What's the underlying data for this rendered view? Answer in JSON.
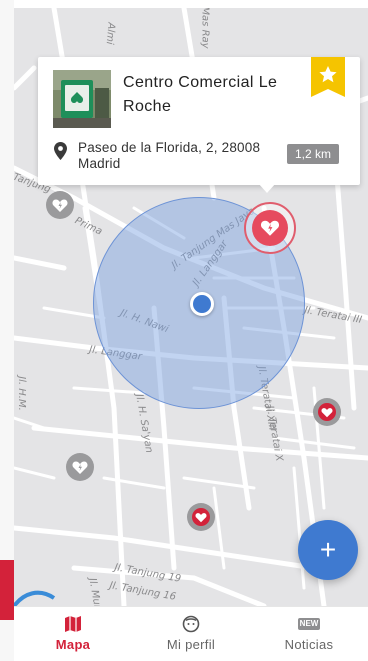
{
  "map": {
    "street_labels": [
      "Mas Ray",
      "Jl. Tanjung Mas Jaya",
      "Jl. Teratai III",
      "Jl. H. Nawi",
      "Jl. Langgar",
      "Jl. Langgar",
      "Jl. H. Sa'yan",
      "Jl. Teratai XIII",
      "Jl. Teratai X",
      "Jl. H.M.",
      "Jl. Tanjung 19",
      "Jl. Tanjung 16",
      "Tanjung",
      "Prima",
      "Almi",
      "Jl. Mur"
    ]
  },
  "card": {
    "title": "Centro Comercial Le Roche",
    "address": "Paseo de la Florida, 2, 28008 Madrid",
    "distance": "1,2 km",
    "favorite_icon": "star-icon",
    "location_icon": "location-pin-icon"
  },
  "fab": {
    "label": "+"
  },
  "nav": {
    "items": [
      {
        "label": "Mapa",
        "icon": "map-icon",
        "active": true
      },
      {
        "label": "Mi perfil",
        "icon": "face-icon",
        "active": false
      },
      {
        "label": "Noticias",
        "icon": "new-badge-icon",
        "badge": "NEW",
        "active": false
      }
    ]
  },
  "colors": {
    "accent": "#d3223a",
    "blue": "#3f7ad0",
    "map_bg": "#e4e4e6"
  }
}
